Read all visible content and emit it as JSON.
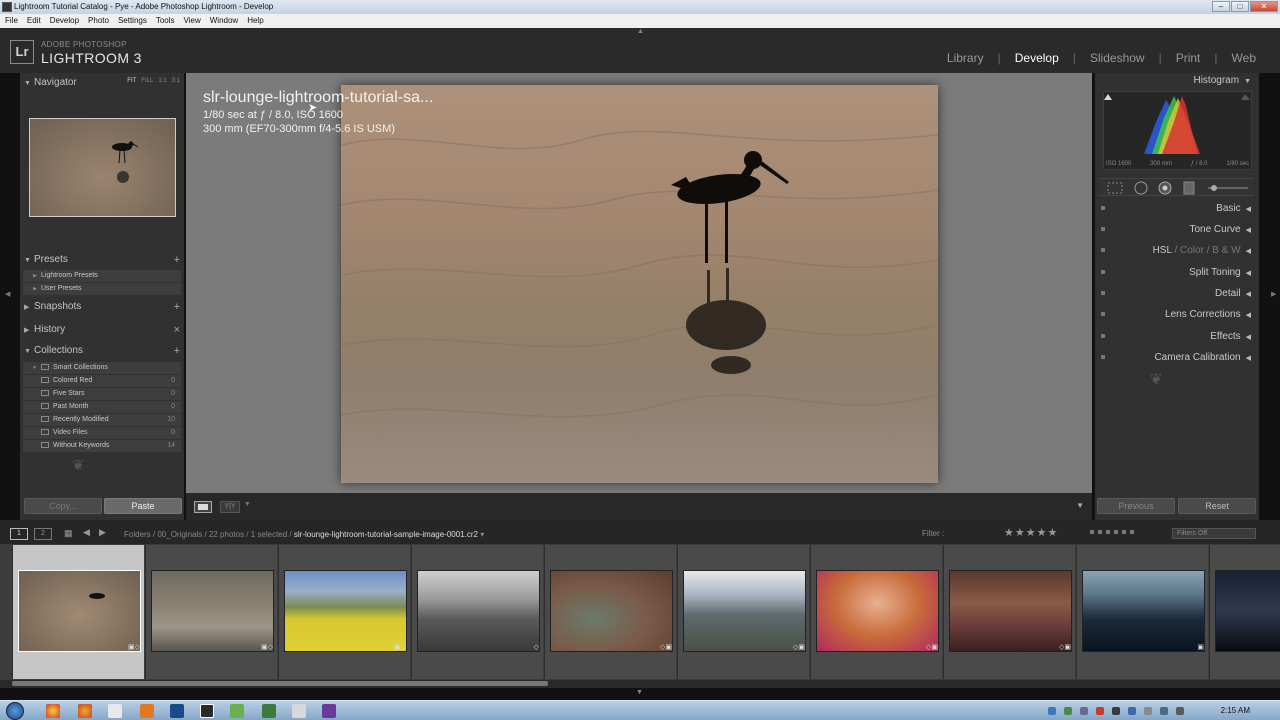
{
  "window": {
    "title": "Lightroom Tutorial Catalog - Pye - Adobe Photoshop Lightroom - Develop"
  },
  "menu": [
    "File",
    "Edit",
    "Develop",
    "Photo",
    "Settings",
    "Tools",
    "View",
    "Window",
    "Help"
  ],
  "branding": {
    "logo": "Lr",
    "sub": "ADOBE PHOTOSHOP",
    "main": "LIGHTROOM 3"
  },
  "modules": {
    "library": "Library",
    "develop": "Develop",
    "slideshow": "Slideshow",
    "print": "Print",
    "web": "Web",
    "sep": "|"
  },
  "navigator": {
    "title": "Navigator",
    "modes": [
      "FIT",
      "FILL",
      "1:1",
      "3:1"
    ]
  },
  "presets": {
    "title": "Presets",
    "items": [
      "Lightroom Presets",
      "User Presets"
    ]
  },
  "snapshots": {
    "title": "Snapshots"
  },
  "history": {
    "title": "History"
  },
  "collections": {
    "title": "Collections",
    "group": "Smart Collections",
    "items": [
      {
        "label": "Colored Red",
        "count": "0"
      },
      {
        "label": "Five Stars",
        "count": "0"
      },
      {
        "label": "Past Month",
        "count": "0"
      },
      {
        "label": "Recently Modified",
        "count": "10"
      },
      {
        "label": "Video Files",
        "count": "0"
      },
      {
        "label": "Without Keywords",
        "count": "14"
      }
    ]
  },
  "left_buttons": {
    "copy": "Copy...",
    "paste": "Paste"
  },
  "photo": {
    "title": "slr-lounge-lightroom-tutorial-sa...",
    "exposure": "1/80 sec at ƒ / 8.0, ISO 1600",
    "lens": "300 mm (EF70-300mm f/4-5.6 IS USM)"
  },
  "histogram": {
    "title": "Histogram",
    "labels": [
      "ISO 1600",
      "300 mm",
      "ƒ / 8.0",
      "1/80 sec"
    ]
  },
  "right_panels": {
    "basic": "Basic",
    "tone_curve": "Tone Curve",
    "hsl": "HSL",
    "color": "Color",
    "bw": "B & W",
    "split_toning": "Split Toning",
    "detail": "Detail",
    "lens_corrections": "Lens Corrections",
    "effects": "Effects",
    "camera_calibration": "Camera Calibration",
    "slash": "/"
  },
  "right_buttons": {
    "previous": "Previous",
    "reset": "Reset"
  },
  "filmstrip": {
    "view1": "1",
    "view2": "2",
    "path": "Folders / 00_Originals / 22 photos / 1 selected /",
    "current_file": "slr-lounge-lightroom-tutorial-sample-image-0001.cr2",
    "filter_label": "Filter :",
    "filter_select": "Filters Off",
    "stars": "★★★★★"
  },
  "taskbar": {
    "clock": "2:15 AM"
  }
}
